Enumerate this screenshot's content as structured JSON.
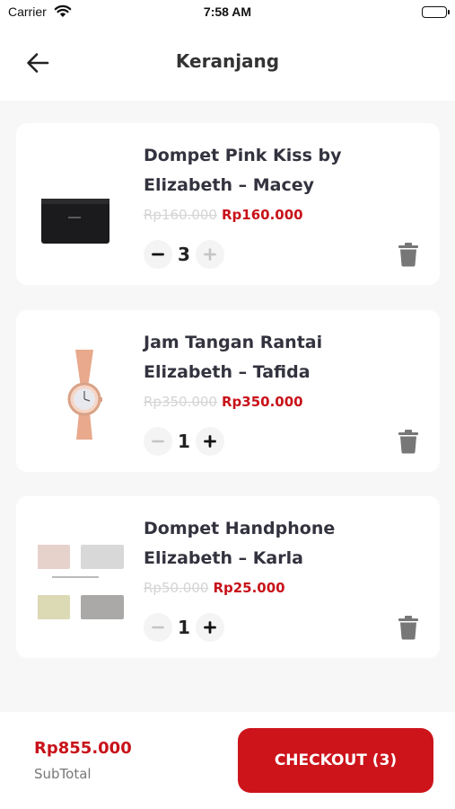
{
  "status_bar": {
    "carrier": "Carrier",
    "time": "7:58 AM"
  },
  "header": {
    "title": "Keranjang",
    "back_icon": "arrow-left-icon"
  },
  "cart": {
    "items": [
      {
        "name": "Dompet Pink Kiss by Elizabeth – Macey",
        "price_original": "Rp160.000",
        "price_final": "Rp160.000",
        "quantity": "3"
      },
      {
        "name": "Jam Tangan Rantai Elizabeth – Tafida",
        "price_original": "Rp350.000",
        "price_final": "Rp350.000",
        "quantity": "1"
      },
      {
        "name": "Dompet Handphone Elizabeth – Karla",
        "price_original": "Rp50.000",
        "price_final": "Rp25.000",
        "quantity": "1"
      }
    ]
  },
  "footer": {
    "subtotal_value": "Rp855.000",
    "subtotal_label": "SubTotal",
    "checkout_label": "CHECKOUT (3)"
  },
  "colors": {
    "accent": "#cd141b",
    "price": "#c8121a",
    "background": "#f7f7f7"
  }
}
